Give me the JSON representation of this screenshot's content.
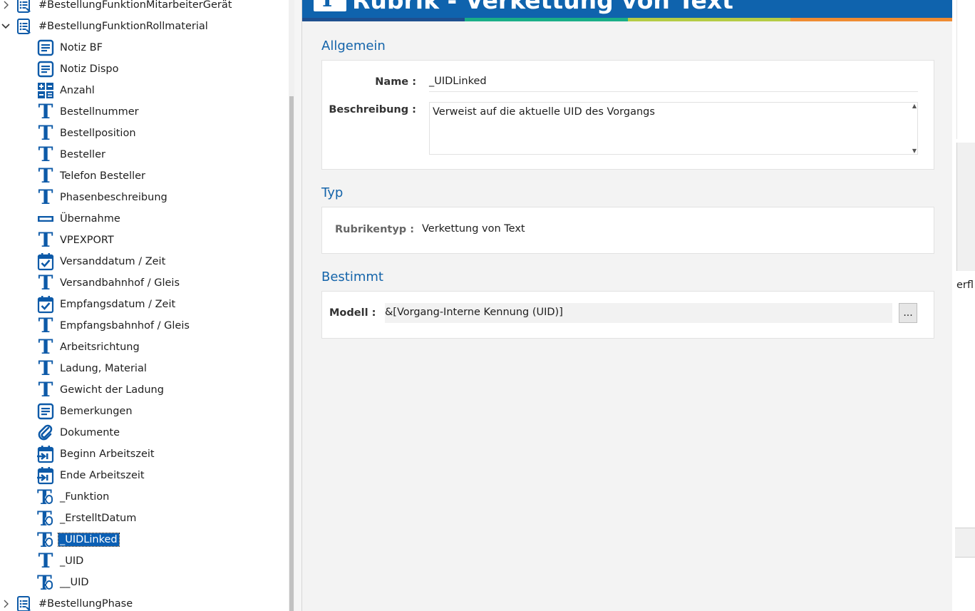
{
  "tree": {
    "items": [
      {
        "label": "#BestellungFunktionMitarbeiterGerät",
        "icon": "list-doc-icon",
        "expander": "collapsed"
      },
      {
        "label": "#BestellungFunktionRollmaterial",
        "icon": "list-doc-icon",
        "expander": "expanded"
      },
      {
        "label": "Notiz BF",
        "icon": "note-icon"
      },
      {
        "label": "Notiz Dispo",
        "icon": "note-icon"
      },
      {
        "label": "Anzahl",
        "icon": "calculator-icon"
      },
      {
        "label": "Bestellnummer",
        "icon": "text-icon"
      },
      {
        "label": "Bestellposition",
        "icon": "text-icon"
      },
      {
        "label": "Besteller",
        "icon": "text-icon"
      },
      {
        "label": "Telefon Besteller",
        "icon": "text-icon"
      },
      {
        "label": "Phasenbeschreibung",
        "icon": "text-icon"
      },
      {
        "label": "Übernahme",
        "icon": "flag-bar-icon"
      },
      {
        "label": "VPEXPORT",
        "icon": "text-icon"
      },
      {
        "label": "Versanddatum / Zeit",
        "icon": "calendar-check-icon"
      },
      {
        "label": "Versandbahnhof / Gleis",
        "icon": "text-icon"
      },
      {
        "label": "Empfangsdatum / Zeit",
        "icon": "calendar-check-icon"
      },
      {
        "label": "Empfangsbahnhof / Gleis",
        "icon": "text-icon"
      },
      {
        "label": "Arbeitsrichtung",
        "icon": "text-icon"
      },
      {
        "label": "Ladung, Material",
        "icon": "text-icon"
      },
      {
        "label": "Gewicht der Ladung",
        "icon": "text-icon"
      },
      {
        "label": "Bemerkungen",
        "icon": "note-icon"
      },
      {
        "label": "Dokumente",
        "icon": "paperclip-icon"
      },
      {
        "label": "Beginn Arbeitszeit",
        "icon": "calendar-arrow-icon"
      },
      {
        "label": "Ende Arbeitszeit",
        "icon": "calendar-arrow-icon"
      },
      {
        "label": "_Funktion",
        "icon": "text-link-icon"
      },
      {
        "label": "_ErstelltDatum",
        "icon": "text-link-icon"
      },
      {
        "label": "_UIDLinked",
        "icon": "text-link-icon",
        "selected": true
      },
      {
        "label": "_UID",
        "icon": "text-icon"
      },
      {
        "label": "__UID",
        "icon": "text-link-icon"
      },
      {
        "label": "#BestellungPhase",
        "icon": "list-doc-icon",
        "expander": "collapsed"
      }
    ]
  },
  "header": {
    "title": "Rubrik - Verkettung von Text",
    "stripe_colors": [
      "#1e4f8f",
      "#1aae87",
      "#b5cc45",
      "#ef8b32"
    ]
  },
  "sections": {
    "allgemein": {
      "title": "Allgemein",
      "name_label": "Name :",
      "name_value": "_UIDLinked",
      "beschreibung_label": "Beschreibung :",
      "beschreibung_value": "Verweist auf die aktuelle UID des Vorgangs"
    },
    "typ": {
      "title": "Typ",
      "rubrikentyp_label": "Rubrikentyp :",
      "rubrikentyp_value": "Verkettung von Text"
    },
    "bestimmt": {
      "title": "Bestimmt",
      "modell_label": "Modell :",
      "modell_value": "&[Vorgang-Interne Kennung (UID)]",
      "browse_label": "..."
    }
  },
  "background_window": {
    "partial_text": "erfl"
  },
  "colors": {
    "accent": "#0f63ad",
    "section_title": "#1464aa",
    "selection": "#0b5fb4"
  }
}
